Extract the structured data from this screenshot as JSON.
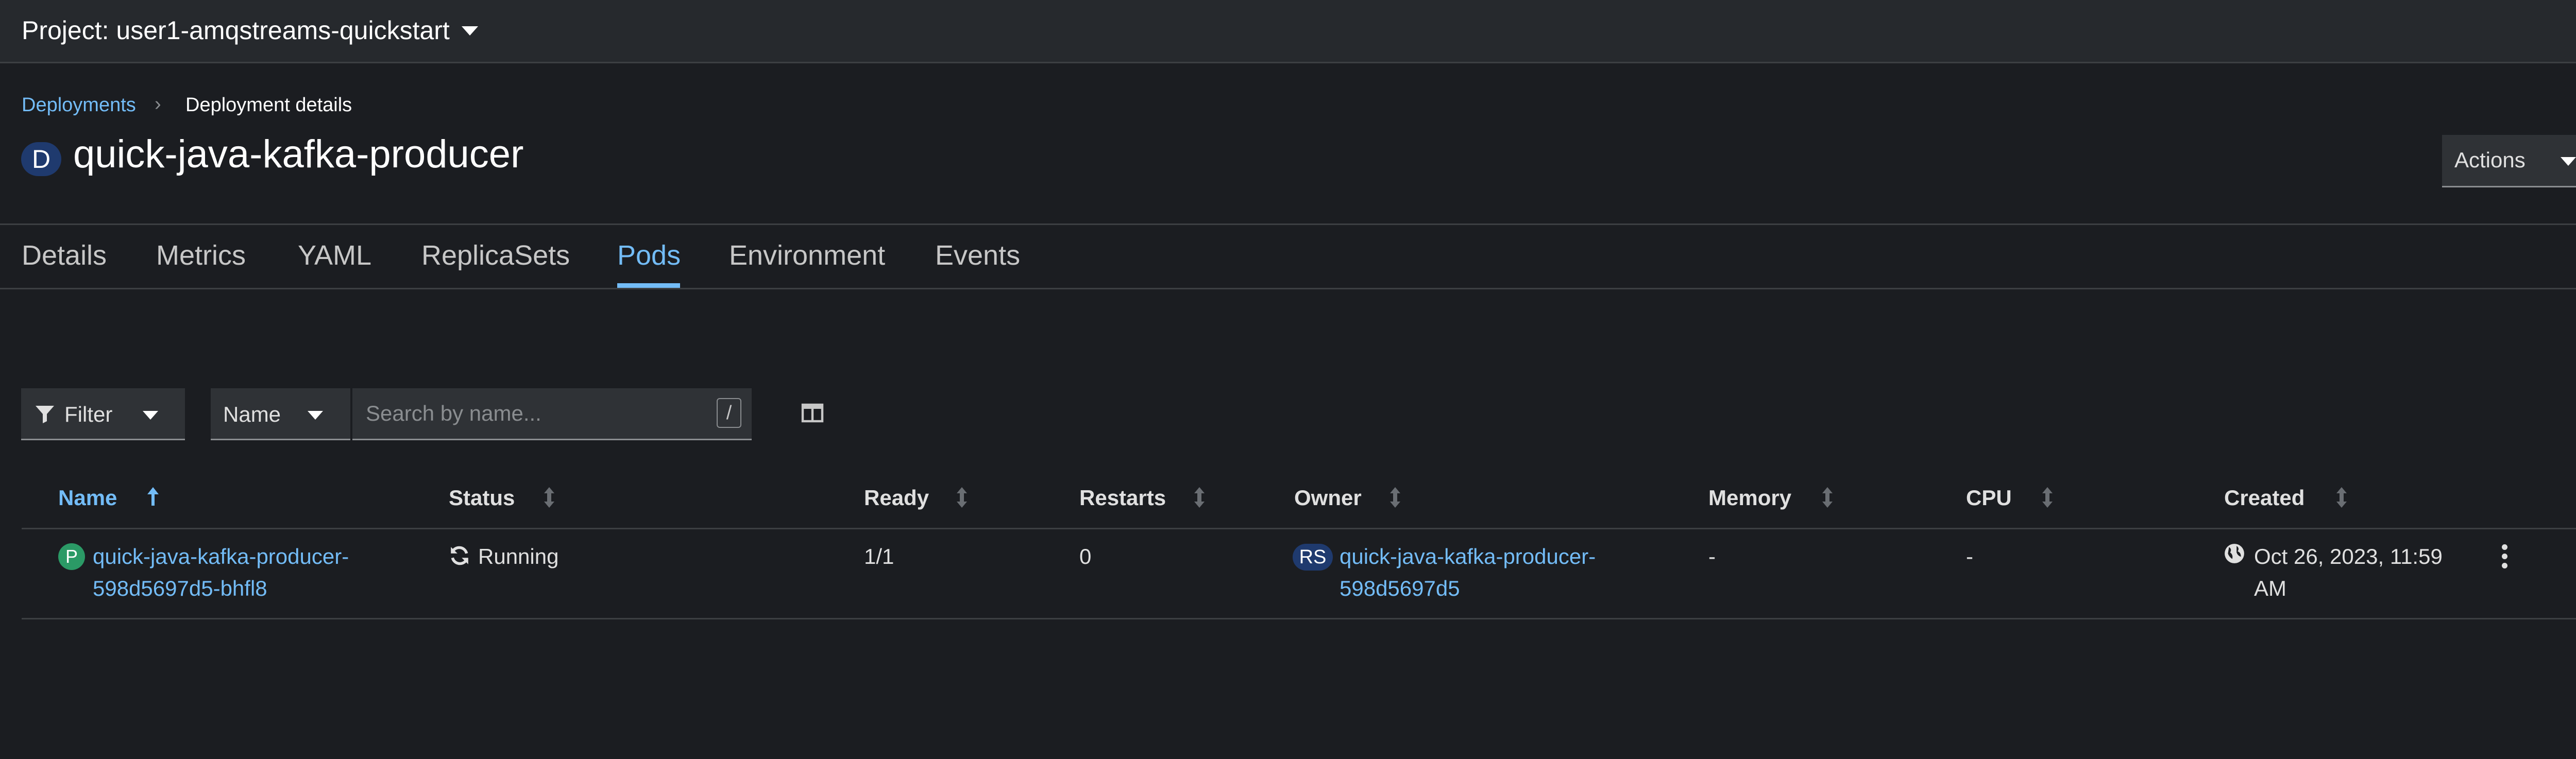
{
  "project_bar": {
    "label": "Project: user1-amqstreams-quickstart"
  },
  "breadcrumb": {
    "parent": "Deployments",
    "separator": "›",
    "current": "Deployment details"
  },
  "header": {
    "badge": "D",
    "title": "quick-java-kafka-producer",
    "actions_label": "Actions"
  },
  "tabs": [
    {
      "label": "Details",
      "active": false
    },
    {
      "label": "Metrics",
      "active": false
    },
    {
      "label": "YAML",
      "active": false
    },
    {
      "label": "ReplicaSets",
      "active": false
    },
    {
      "label": "Pods",
      "active": true
    },
    {
      "label": "Environment",
      "active": false
    },
    {
      "label": "Events",
      "active": false
    }
  ],
  "toolbar": {
    "filter_label": "Filter",
    "name_select": "Name",
    "search_placeholder": "Search by name...",
    "search_shortcut": "/"
  },
  "table": {
    "columns": [
      "Name",
      "Status",
      "Ready",
      "Restarts",
      "Owner",
      "Memory",
      "CPU",
      "Created"
    ],
    "sorted_column": "Name",
    "rows": [
      {
        "badge": "P",
        "name_line1": "quick-java-kafka-producer-",
        "name_line2": "598d5697d5-bhfl8",
        "status": "Running",
        "ready": "1/1",
        "restarts": "0",
        "owner_badge": "RS",
        "owner_line1": "quick-java-kafka-producer-",
        "owner_line2": "598d5697d5",
        "memory": "-",
        "cpu": "-",
        "created_line1": "Oct 26, 2023, 11:59",
        "created_line2": "AM"
      }
    ]
  },
  "colors": {
    "background": "#1b1d21",
    "link": "#73bcf7",
    "pod_badge": "#2b9a66",
    "deployment_badge": "#1f3a6e"
  },
  "icons": [
    "caret-down-icon",
    "angle-right-icon",
    "filter-icon",
    "columns-icon",
    "sort-icon",
    "sync-icon",
    "globe-icon",
    "kebab-icon"
  ]
}
